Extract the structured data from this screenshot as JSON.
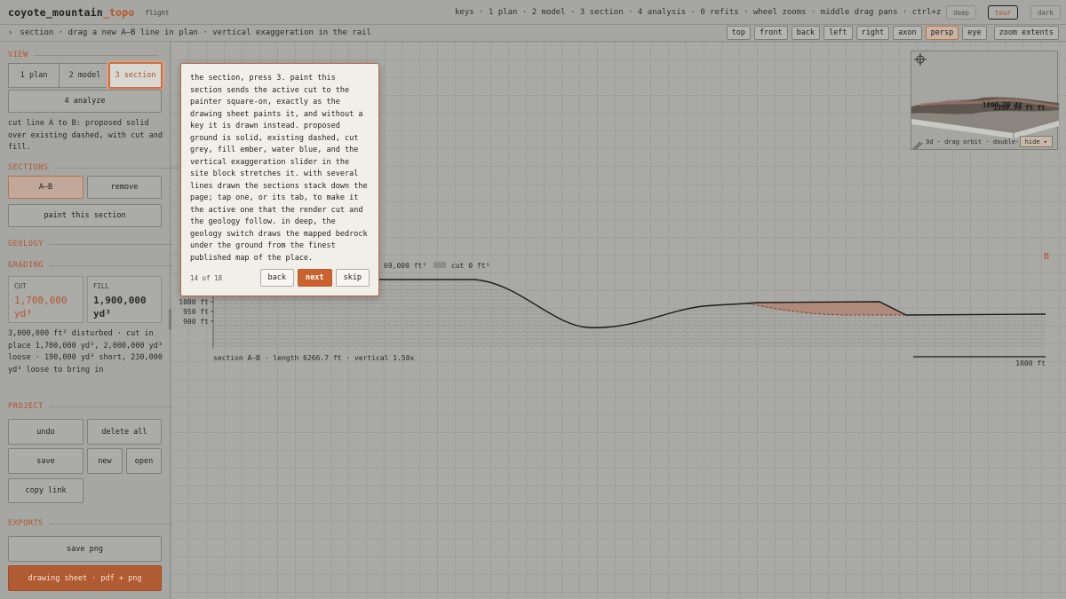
{
  "brand": {
    "name_main": "coyote_mountain",
    "name_accent": "_topo",
    "subtitle": "flight"
  },
  "keys_hint": "keys · 1 plan · 2 model · 3 section · 4 analysis · 0 refits · wheel zooms · middle drag pans · ctrl+z undo",
  "modes": [
    {
      "label": "deep"
    },
    {
      "label": "tour"
    },
    {
      "label": "dark"
    }
  ],
  "subbar": {
    "chevron": "›",
    "text": "section · drag a new A–B line in plan · vertical exaggeration in the rail"
  },
  "views": [
    "top",
    "front",
    "back",
    "left",
    "right",
    "axon",
    "persp",
    "eye"
  ],
  "zoom_extents": "zoom extents",
  "sidebar": {
    "view_h": "VIEW",
    "view_modes": [
      "1 plan",
      "2 model",
      "3 section"
    ],
    "analyze": "4 analyze",
    "view_note": "cut line A to B: proposed solid over existing dashed, with cut and fill.",
    "sections_h": "SECTIONS",
    "section_tab": "A–B",
    "remove": "remove",
    "paint": "paint this section",
    "geology_h": "GEOLOGY",
    "grading_h": "GRADING",
    "cut_label": "CUT",
    "cut_value_1": "1,700,000",
    "cut_value_2": "yd³",
    "fill_label": "FILL",
    "fill_value_1": "1,900,000",
    "fill_value_2": "yd³",
    "grading_note": "3,000,000 ft² disturbed · cut in place 1,700,000 yd³, 2,000,000 yd³ loose · 190,000 yd³ short, 230,000 yd³ loose to bring in",
    "project_h": "PROJECT",
    "undo": "undo",
    "delete_all": "delete all",
    "save": "save",
    "new": "new",
    "open": "open",
    "copy_link": "copy link",
    "exports_h": "EXPORTS",
    "save_png": "save png",
    "drawing_sheet": "drawing sheet · pdf + png"
  },
  "popup": {
    "text": "the section, press 3. paint this section sends the active cut to the painter square-on, exactly as the drawing sheet paints it, and without a key it is drawn instead. proposed ground is solid, existing dashed, cut grey, fill ember, water blue, and the vertical exaggeration slider in the site block stretches it. with several lines drawn the sections stack down the page; tap one, or its tab, to make it the active one that the render cut and the geology follow. in deep, the geology switch draws the mapped bedrock under the ground from the finest published map of the place.",
    "count": "14 of 18",
    "back": "back",
    "next": "next",
    "skip": "skip"
  },
  "section": {
    "fill_legend": "69,000 ft³",
    "cut_legend": "cut 0 ft³",
    "end_label": "B",
    "y_ticks": [
      "1000 ft",
      "950 ft",
      "900 ft"
    ],
    "caption": "section A–B · length 6266.7 ft · vertical 1.50x",
    "scale_label": "1000 ft"
  },
  "minimap": {
    "caption": "3d · drag orbit · double-",
    "hide": "hide ▾",
    "label_1": "1000.79 ft",
    "label_2": "1350.59 ft ft"
  }
}
